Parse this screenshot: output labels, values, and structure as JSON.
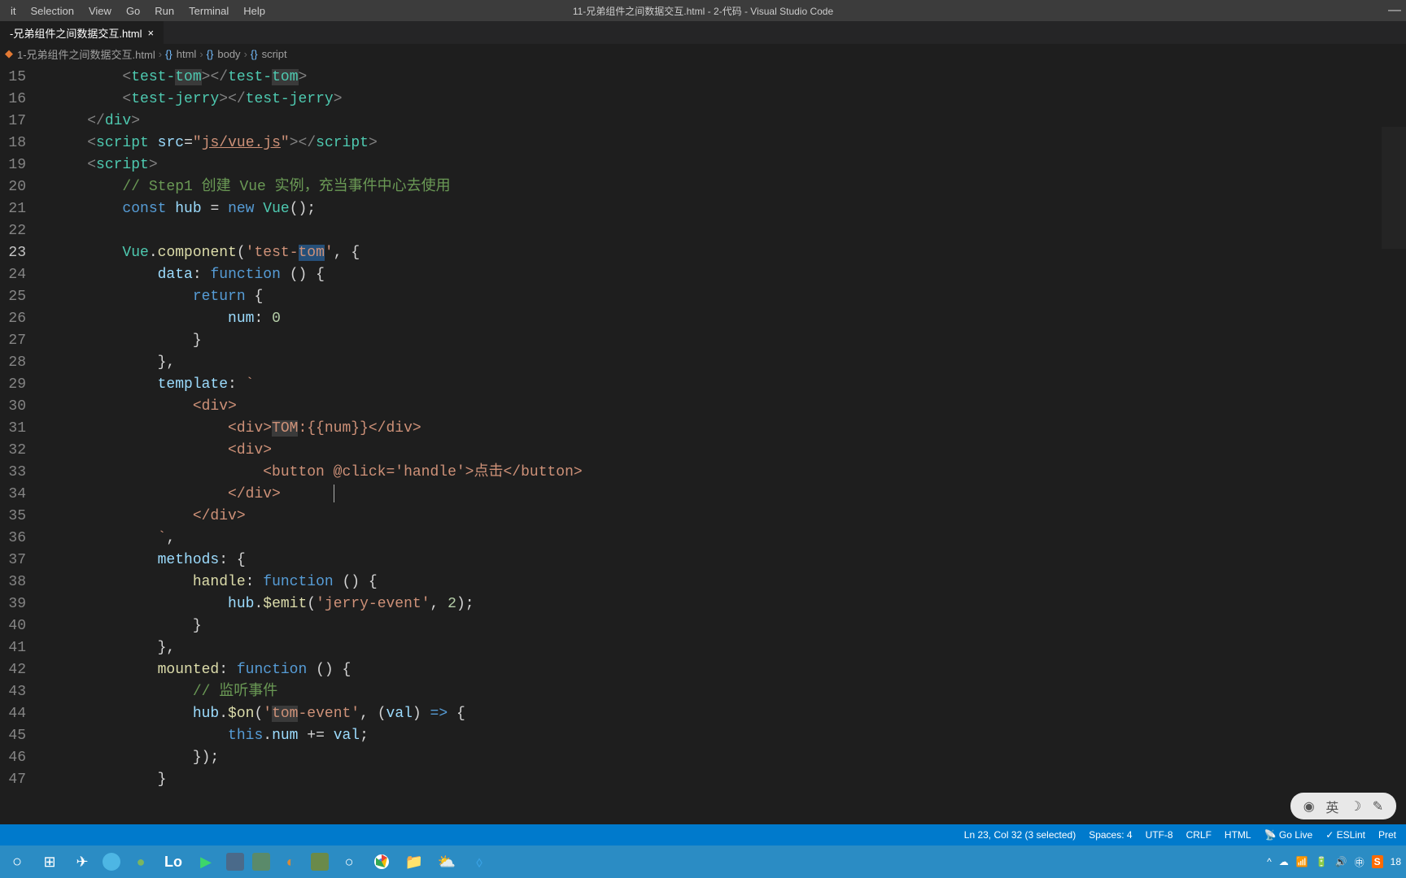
{
  "menubar": [
    "it",
    "Selection",
    "View",
    "Go",
    "Run",
    "Terminal",
    "Help"
  ],
  "window_title": "11-兄弟组件之间数据交互.html - 2-代码 - Visual Studio Code",
  "tab": {
    "label": "-兄弟组件之间数据交互.html"
  },
  "breadcrumbs": [
    "1-兄弟组件之间数据交互.html",
    "html",
    "body",
    "script"
  ],
  "line_start": 15,
  "line_count": 33,
  "current_line_index": 8,
  "code_tokens": [
    [
      [
        "        ",
        "op"
      ],
      [
        "<",
        "brack"
      ],
      [
        "test-",
        "tag"
      ],
      [
        "tom",
        "tag hl"
      ],
      [
        ">",
        "brack"
      ],
      [
        "</",
        "brack"
      ],
      [
        "test-",
        "tag"
      ],
      [
        "tom",
        "tag hl"
      ],
      [
        ">",
        "brack"
      ]
    ],
    [
      [
        "        ",
        "op"
      ],
      [
        "<",
        "brack"
      ],
      [
        "test-jerry",
        "tag"
      ],
      [
        ">",
        "brack"
      ],
      [
        "</",
        "brack"
      ],
      [
        "test-jerry",
        "tag"
      ],
      [
        ">",
        "brack"
      ]
    ],
    [
      [
        "    ",
        "op"
      ],
      [
        "</",
        "brack"
      ],
      [
        "div",
        "tag"
      ],
      [
        ">",
        "brack"
      ]
    ],
    [
      [
        "    ",
        "op"
      ],
      [
        "<",
        "brack"
      ],
      [
        "script",
        "tag"
      ],
      [
        " ",
        "op"
      ],
      [
        "src",
        "attr"
      ],
      [
        "=",
        "op"
      ],
      [
        "\"",
        "str"
      ],
      [
        "js/vue.js",
        "str-u"
      ],
      [
        "\"",
        "str"
      ],
      [
        ">",
        "brack"
      ],
      [
        "</",
        "brack"
      ],
      [
        "script",
        "tag"
      ],
      [
        ">",
        "brack"
      ]
    ],
    [
      [
        "    ",
        "op"
      ],
      [
        "<",
        "brack"
      ],
      [
        "script",
        "tag"
      ],
      [
        ">",
        "brack"
      ]
    ],
    [
      [
        "        ",
        "op"
      ],
      [
        "// Step1 创建 Vue 实例，充当事件中心去使用",
        "cmt"
      ]
    ],
    [
      [
        "        ",
        "op"
      ],
      [
        "const",
        "kw"
      ],
      [
        " ",
        "op"
      ],
      [
        "hub",
        "var"
      ],
      [
        " = ",
        "op"
      ],
      [
        "new",
        "kw"
      ],
      [
        " ",
        "op"
      ],
      [
        "Vue",
        "cls"
      ],
      [
        "();",
        "punc"
      ]
    ],
    [
      [
        "",
        "op"
      ]
    ],
    [
      [
        "        ",
        "op"
      ],
      [
        "Vue",
        "cls"
      ],
      [
        ".",
        "op"
      ],
      [
        "component",
        "fn"
      ],
      [
        "(",
        "punc"
      ],
      [
        "'",
        "str"
      ],
      [
        "test-",
        "str"
      ],
      [
        "tom",
        "str sel"
      ],
      [
        "'",
        "str"
      ],
      [
        ", {",
        "punc"
      ]
    ],
    [
      [
        "            ",
        "op"
      ],
      [
        "data",
        "var"
      ],
      [
        ":",
        "punc"
      ],
      [
        " ",
        "op"
      ],
      [
        "function",
        "kw"
      ],
      [
        " () {",
        "punc"
      ]
    ],
    [
      [
        "                ",
        "op"
      ],
      [
        "return",
        "kw"
      ],
      [
        " {",
        "punc"
      ]
    ],
    [
      [
        "                    ",
        "op"
      ],
      [
        "num",
        "var"
      ],
      [
        ":",
        "punc"
      ],
      [
        " ",
        "op"
      ],
      [
        "0",
        "num"
      ]
    ],
    [
      [
        "                }",
        "punc"
      ]
    ],
    [
      [
        "            },",
        "punc"
      ]
    ],
    [
      [
        "            ",
        "op"
      ],
      [
        "template",
        "var"
      ],
      [
        ":",
        "punc"
      ],
      [
        " ",
        "op"
      ],
      [
        "`",
        "str"
      ]
    ],
    [
      [
        "                <div>",
        "str"
      ]
    ],
    [
      [
        "                    <div>",
        "str"
      ],
      [
        "TOM",
        "str hl"
      ],
      [
        ":{{num}}</div>",
        "str"
      ]
    ],
    [
      [
        "                    <div>",
        "str"
      ]
    ],
    [
      [
        "                        <button @click='handle'>点击</button>",
        "str"
      ]
    ],
    [
      [
        "                    </div>",
        "str"
      ]
    ],
    [
      [
        "                </div>",
        "str"
      ]
    ],
    [
      [
        "            `",
        "str"
      ],
      [
        ",",
        "punc"
      ]
    ],
    [
      [
        "            ",
        "op"
      ],
      [
        "methods",
        "var"
      ],
      [
        ":",
        "punc"
      ],
      [
        " {",
        "punc"
      ]
    ],
    [
      [
        "                ",
        "op"
      ],
      [
        "handle",
        "fn"
      ],
      [
        ":",
        "punc"
      ],
      [
        " ",
        "op"
      ],
      [
        "function",
        "kw"
      ],
      [
        " () {",
        "punc"
      ]
    ],
    [
      [
        "                    ",
        "op"
      ],
      [
        "hub",
        "var"
      ],
      [
        ".",
        "op"
      ],
      [
        "$emit",
        "fn"
      ],
      [
        "(",
        "punc"
      ],
      [
        "'jerry-event'",
        "str"
      ],
      [
        ", ",
        "punc"
      ],
      [
        "2",
        "num"
      ],
      [
        ");",
        "punc"
      ]
    ],
    [
      [
        "                }",
        "punc"
      ]
    ],
    [
      [
        "            },",
        "punc"
      ]
    ],
    [
      [
        "            ",
        "op"
      ],
      [
        "mounted",
        "fn"
      ],
      [
        ":",
        "punc"
      ],
      [
        " ",
        "op"
      ],
      [
        "function",
        "kw"
      ],
      [
        " () {",
        "punc"
      ]
    ],
    [
      [
        "                ",
        "op"
      ],
      [
        "// 监听事件",
        "cmt"
      ]
    ],
    [
      [
        "                ",
        "op"
      ],
      [
        "hub",
        "var"
      ],
      [
        ".",
        "op"
      ],
      [
        "$on",
        "fn"
      ],
      [
        "(",
        "punc"
      ],
      [
        "'",
        "str"
      ],
      [
        "tom",
        "str hl"
      ],
      [
        "-event'",
        "str"
      ],
      [
        ", (",
        "punc"
      ],
      [
        "val",
        "var"
      ],
      [
        ") ",
        "punc"
      ],
      [
        "=>",
        "arrow"
      ],
      [
        " {",
        "punc"
      ]
    ],
    [
      [
        "                    ",
        "op"
      ],
      [
        "this",
        "this"
      ],
      [
        ".",
        "op"
      ],
      [
        "num",
        "var"
      ],
      [
        " += ",
        "op"
      ],
      [
        "val",
        "var"
      ],
      [
        ";",
        "punc"
      ]
    ],
    [
      [
        "                });",
        "punc"
      ]
    ],
    [
      [
        "            }",
        "punc"
      ]
    ]
  ],
  "cursor_position": {
    "line_index": 19,
    "after_token_text": "                    </div>"
  },
  "status": {
    "selection": "Ln 23, Col 32 (3 selected)",
    "spaces": "Spaces: 4",
    "encoding": "UTF-8",
    "eol": "CRLF",
    "lang": "HTML",
    "golive": "Go Live",
    "eslint": "ESLint",
    "prettier": "Pret"
  },
  "ime": {
    "lang": "英"
  },
  "tray_time": "18"
}
